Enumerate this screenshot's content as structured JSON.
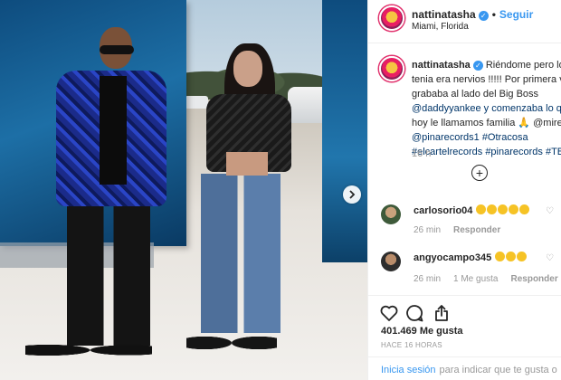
{
  "post": {
    "username": "nattinatasha",
    "follow_label": "Seguir",
    "location": "Miami, Florida",
    "separator": "•"
  },
  "caption": {
    "username": "nattinatasha",
    "lines": [
      "Riéndome pero lo q",
      "tenia era nervios !!!!! Por primera vez",
      "grababa al lado del Big Boss",
      "@daddyyankee y comenzaba lo que",
      "hoy le llamamos familia 🙏 @miredo",
      "@pinarecords1 #Otracosa",
      "#elcartelrecords #pinarecords #TBT"
    ],
    "time": "16 h"
  },
  "comments": [
    {
      "username": "carlosorio04",
      "emoji_count": 5,
      "time": "26 min",
      "likes": "",
      "reply": "Responder"
    },
    {
      "username": "angyocampo345",
      "emoji_count": 3,
      "time": "26 min",
      "likes": "1 Me gusta",
      "reply": "Responder"
    }
  ],
  "stats": {
    "likes": "401.469 Me gusta",
    "ago": "HACE 16 HORAS"
  },
  "footer": {
    "login_link": "Inicia sesión",
    "login_text": "para indicar que te gusta o"
  },
  "icons": {
    "verified": "verified-badge-icon",
    "next": "chevron-right-icon",
    "load_more": "plus-circle-icon",
    "like": "heart-icon",
    "comment": "comment-bubble-icon",
    "share": "share-upload-icon"
  },
  "colors": {
    "link": "#3897f0",
    "text": "#262626",
    "muted": "#999999",
    "hashtag": "#003569"
  }
}
